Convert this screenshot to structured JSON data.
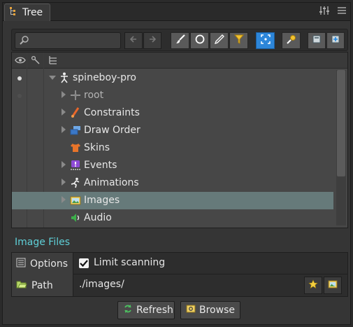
{
  "window": {
    "tab_title": "Tree"
  },
  "toolbar": {
    "search_placeholder": "",
    "buttons": [
      "back-icon",
      "forward-icon",
      "brush-icon",
      "circle-icon",
      "pencil-icon",
      "filter-icon",
      "focus-icon",
      "pin-icon",
      "collapse-icon",
      "expand-icon"
    ]
  },
  "tree": {
    "rows": [
      {
        "label": "spineboy-pro",
        "icon": "skeleton-icon",
        "expanded": true
      },
      {
        "label": "root",
        "icon": "bone-icon"
      },
      {
        "label": "Constraints",
        "icon": "constraint-icon"
      },
      {
        "label": "Draw Order",
        "icon": "draw-order-icon"
      },
      {
        "label": "Skins",
        "icon": "skin-icon"
      },
      {
        "label": "Events",
        "icon": "event-icon"
      },
      {
        "label": "Animations",
        "icon": "animation-icon"
      },
      {
        "label": "Images",
        "icon": "images-icon",
        "selected": true
      },
      {
        "label": "Audio",
        "icon": "audio-icon"
      }
    ]
  },
  "section": {
    "title": "Image Files"
  },
  "properties": {
    "options_label": "Options",
    "limit_scanning_label": "Limit scanning",
    "limit_scanning_checked": true,
    "path_label": "Path",
    "path_value": "./images/"
  },
  "actions": {
    "refresh_label": "Refresh",
    "browse_label": "Browse"
  },
  "colors": {
    "accent": "#2d86d9",
    "section_title": "#5fd0d8",
    "selected_row": "#667a7a"
  }
}
